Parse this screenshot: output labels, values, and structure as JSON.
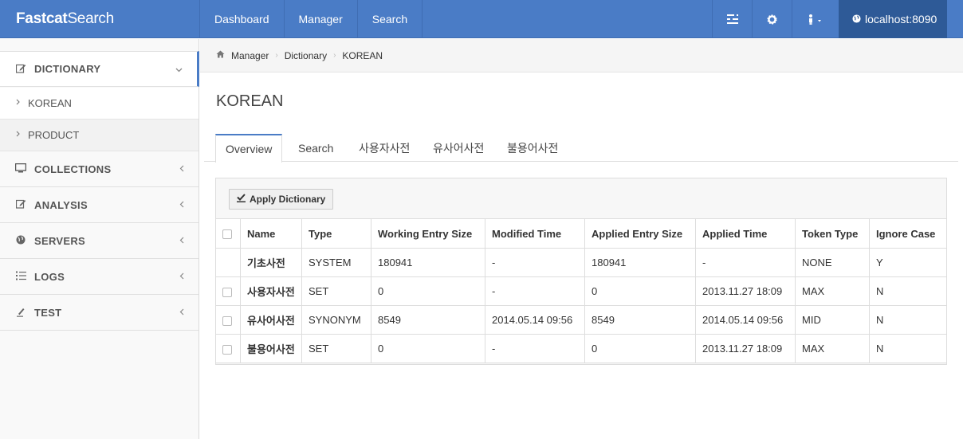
{
  "brand": {
    "bold": "Fastcat",
    "rest": "Search"
  },
  "topnav": {
    "links": [
      "Dashboard",
      "Manager",
      "Search"
    ],
    "host": "localhost:8090"
  },
  "sidebar": {
    "items": [
      {
        "label": "DICTIONARY",
        "icon": "edit-icon",
        "expanded": true
      },
      {
        "label": "COLLECTIONS",
        "icon": "monitor-icon"
      },
      {
        "label": "ANALYSIS",
        "icon": "edit-icon"
      },
      {
        "label": "SERVERS",
        "icon": "globe-icon"
      },
      {
        "label": "LOGS",
        "icon": "list-icon"
      },
      {
        "label": "TEST",
        "icon": "pencil-icon"
      }
    ],
    "subitems": [
      "KOREAN",
      "PRODUCT"
    ]
  },
  "breadcrumb": [
    "Manager",
    "Dictionary",
    "KOREAN"
  ],
  "page": {
    "title": "KOREAN"
  },
  "tabs": [
    "Overview",
    "Search",
    "사용자사전",
    "유사어사전",
    "불용어사전"
  ],
  "toolbar": {
    "apply_label": "Apply Dictionary"
  },
  "table": {
    "headers": [
      "Name",
      "Type",
      "Working Entry Size",
      "Modified Time",
      "Applied Entry Size",
      "Applied Time",
      "Token Type",
      "Ignore Case"
    ],
    "rows": [
      [
        "기초사전",
        "SYSTEM",
        "180941",
        "-",
        "180941",
        "-",
        "NONE",
        "Y"
      ],
      [
        "사용자사전",
        "SET",
        "0",
        "-",
        "0",
        "2013.11.27 18:09",
        "MAX",
        "N"
      ],
      [
        "유사어사전",
        "SYNONYM",
        "8549",
        "2014.05.14 09:56",
        "8549",
        "2014.05.14 09:56",
        "MID",
        "N"
      ],
      [
        "불용어사전",
        "SET",
        "0",
        "-",
        "0",
        "2013.11.27 18:09",
        "MAX",
        "N"
      ]
    ]
  },
  "colors": {
    "navbar": "#4a7cc6",
    "host_bg": "#2e5a97"
  }
}
